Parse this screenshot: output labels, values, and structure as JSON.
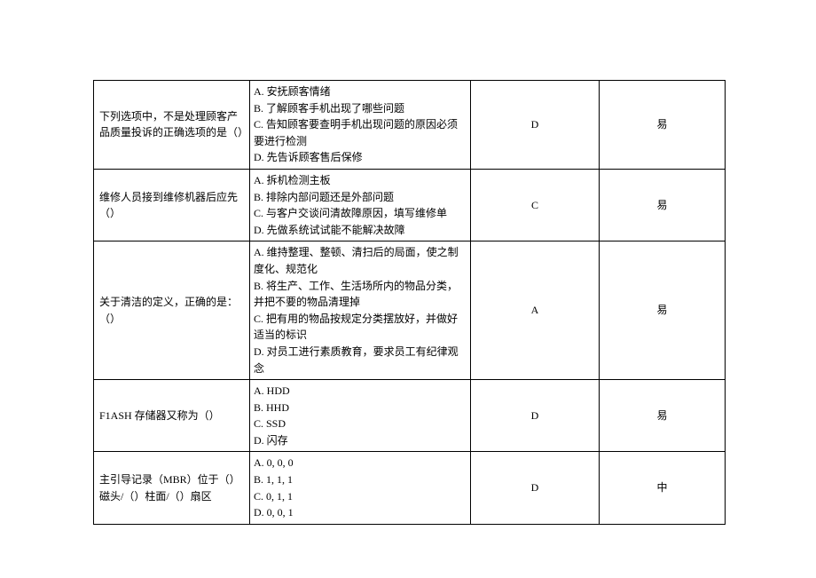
{
  "rows": [
    {
      "question": "下列选项中，不是处理顾客产品质量投诉的正确选项的是（）",
      "options": [
        "A. 安抚顾客情绪",
        "B. 了解顾客手机出现了哪些问题",
        "C. 告知顾客要查明手机出现问题的原因必须要进行检测",
        "D. 先告诉顾客售后保修"
      ],
      "answer": "D",
      "level": "易"
    },
    {
      "question": "维修人员接到维修机器后应先（）",
      "options": [
        "A. 拆机检测主板",
        "B. 排除内部问题还是外部问题",
        "C. 与客户交谈问清故障原因，填写维修单",
        "D. 先做系统试试能不能解决故障"
      ],
      "answer": "C",
      "level": "易"
    },
    {
      "question": "关于清洁的定义，正确的是：（）",
      "options": [
        "A. 维持整理、整顿、清扫后的局面，使之制度化、规范化",
        "B. 将生产、工作、生活场所内的物品分类，并把不要的物品清理掉",
        "C. 把有用的物品按规定分类摆放好，并做好适当的标识",
        "D. 对员工进行素质教育，要求员工有纪律观念"
      ],
      "answer": "A",
      "level": "易"
    },
    {
      "question": "F1ASH 存储器又称为（）",
      "options": [
        "A. HDD",
        "B. HHD",
        "C. SSD",
        "D. 闪存"
      ],
      "answer": "D",
      "level": "易"
    },
    {
      "question": "主引导记录（MBR）位于（）磁头/（）柱面/（）扇区",
      "options": [
        "A. 0, 0, 0",
        "B. 1, 1, 1",
        "C. 0, 1, 1",
        "D. 0, 0, 1"
      ],
      "answer": "D",
      "level": "中"
    }
  ]
}
